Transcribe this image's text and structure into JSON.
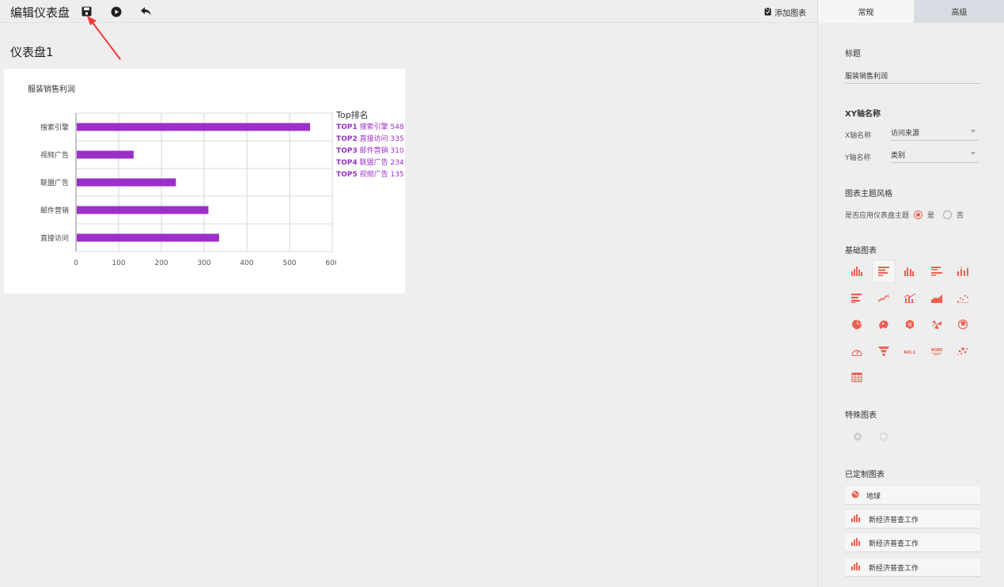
{
  "topbar": {
    "title": "编辑仪表盘",
    "add_chart_label": "添加图表",
    "icons": [
      "save-icon",
      "play-icon",
      "undo-icon",
      "clipboard-icon"
    ]
  },
  "dashboard": {
    "title": "仪表盘1"
  },
  "widget": {
    "title": "服装销售利润",
    "legend_title": "Top排名",
    "legend": [
      {
        "rank": "TOP1",
        "text": "搜索引擎 548"
      },
      {
        "rank": "TOP2",
        "text": "直接访问 335"
      },
      {
        "rank": "TOP3",
        "text": "邮件营销 310"
      },
      {
        "rank": "TOP4",
        "text": "联盟广告 234"
      },
      {
        "rank": "TOP5",
        "text": "视频广告 135"
      }
    ]
  },
  "chart_data": {
    "type": "bar",
    "orientation": "horizontal",
    "title": "服装销售利润",
    "categories": [
      "搜索引擎",
      "视频广告",
      "联盟广告",
      "邮件营销",
      "直接访问"
    ],
    "values": [
      548,
      135,
      234,
      310,
      335
    ],
    "xlim": [
      0,
      600
    ],
    "xticks": [
      0,
      100,
      200,
      300,
      400,
      500,
      600
    ],
    "grid": true,
    "legend_position": "right",
    "bar_color": "#9b30c8"
  },
  "panel": {
    "tabs": [
      "常规",
      "高级"
    ],
    "title_section": "标题",
    "title_value": "服装销售利润",
    "xy_section": "XY轴名称",
    "x_label": "X轴名称",
    "x_value": "访问来源",
    "y_label": "Y轴名称",
    "y_value": "类别",
    "theme_section": "图表主题风格",
    "theme_question": "是否应用仪表盘主题",
    "yes": "是",
    "no": "否",
    "basic_section": "基础图表",
    "basic_icons": [
      "bar-chart-icon",
      "horizontal-bar-icon",
      "grouped-bar-icon",
      "horizontal-grouped-bar-icon",
      "bar-with-dots-icon",
      "stacked-horizontal-bar-icon",
      "line-chart-icon",
      "line-bar-icon",
      "area-chart-icon",
      "scatter-icon",
      "pie-chart-icon",
      "map-icon",
      "hexagon-map-icon",
      "rose-icon",
      "globe-icon",
      "gauge-icon",
      "funnel-icon",
      "number-card-icon",
      "word-cloud-icon",
      "scatter-map-icon",
      "table-icon"
    ],
    "number_card_text": "(NO.1)",
    "word_cloud_text": "WORD",
    "special_section": "特殊图表",
    "special_icons": [
      "special-chart-1-icon",
      "special-chart-2-icon"
    ],
    "custom_section": "已定制图表",
    "custom_items": [
      {
        "label": "地球",
        "icon": "globe-icon"
      },
      {
        "label": "新经济普查工作",
        "icon": "bar-chart-icon"
      },
      {
        "label": "新经济普查工作",
        "icon": "bar-chart-icon"
      },
      {
        "label": "新经济普查工作",
        "icon": "bar-chart-icon"
      }
    ]
  },
  "colors": {
    "accent": "#ee5f4f",
    "bar": "#9b30c8",
    "arrow": "#f23a3a"
  }
}
